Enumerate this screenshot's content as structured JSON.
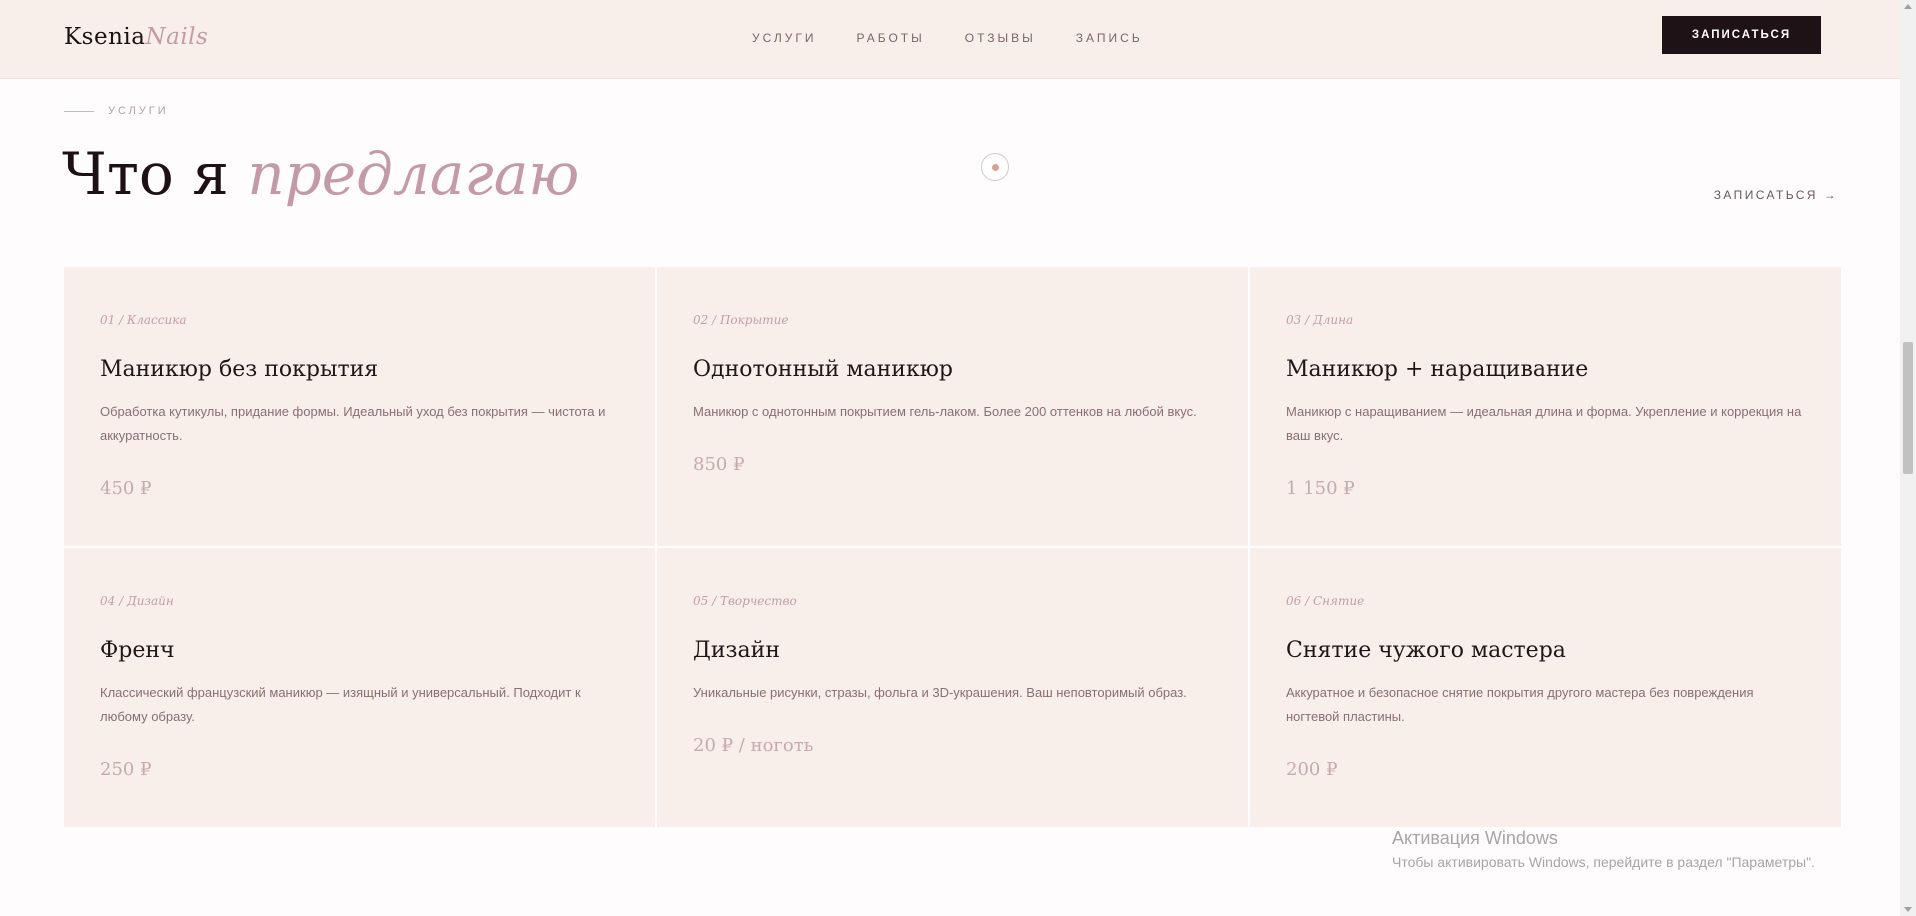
{
  "header": {
    "logo_part1": "Ksenia",
    "logo_part2": "Nails",
    "nav": [
      "УСЛУГИ",
      "РАБОТЫ",
      "ОТЗЫВЫ",
      "ЗАПИСЬ"
    ],
    "cta": "ЗАПИСАТЬСЯ"
  },
  "section": {
    "label": "УСЛУГИ",
    "heading_plain": "Что я ",
    "heading_accent": "предлагаю",
    "book_link": "ЗАПИСАТЬСЯ →"
  },
  "services": [
    {
      "index": "01 / Классика",
      "title": "Маникюр без покрытия",
      "description": "Обработка кутикулы, придание формы. Идеальный уход без покрытия — чистота и аккуратность.",
      "price": "450 ₽"
    },
    {
      "index": "02 / Покрытие",
      "title": "Однотонный маникюр",
      "description": "Маникюр с однотонным покрытием гель-лаком. Более 200 оттенков на любой вкус.",
      "price": "850 ₽"
    },
    {
      "index": "03 / Длина",
      "title": "Маникюр + наращивание",
      "description": "Маникюр с наращиванием — идеальная длина и форма. Укрепление и коррекция на ваш вкус.",
      "price": "1 150 ₽"
    },
    {
      "index": "04 / Дизайн",
      "title": "Френч",
      "description": "Классический французский маникюр — изящный и универсальный. Подходит к любому образу.",
      "price": "250 ₽"
    },
    {
      "index": "05 / Творчество",
      "title": "Дизайн",
      "description": "Уникальные рисунки, стразы, фольга и 3D-украшения. Ваш неповторимый образ.",
      "price": "20 ₽ / ноготь"
    },
    {
      "index": "06 / Снятие",
      "title": "Снятие чужого мастера",
      "description": "Аккуратное и безопасное снятие покрытия другого мастера без повреждения ногтевой пластины.",
      "price": "200 ₽"
    }
  ],
  "watermark": {
    "title": "Активация Windows",
    "subtitle": "Чтобы активировать Windows, перейдите в раздел \"Параметры\"."
  },
  "colors": {
    "accent": "#c39aa9",
    "header_bg": "#f8efeb",
    "card_bg": "#f8eeea",
    "button_bg": "#1f1216"
  }
}
